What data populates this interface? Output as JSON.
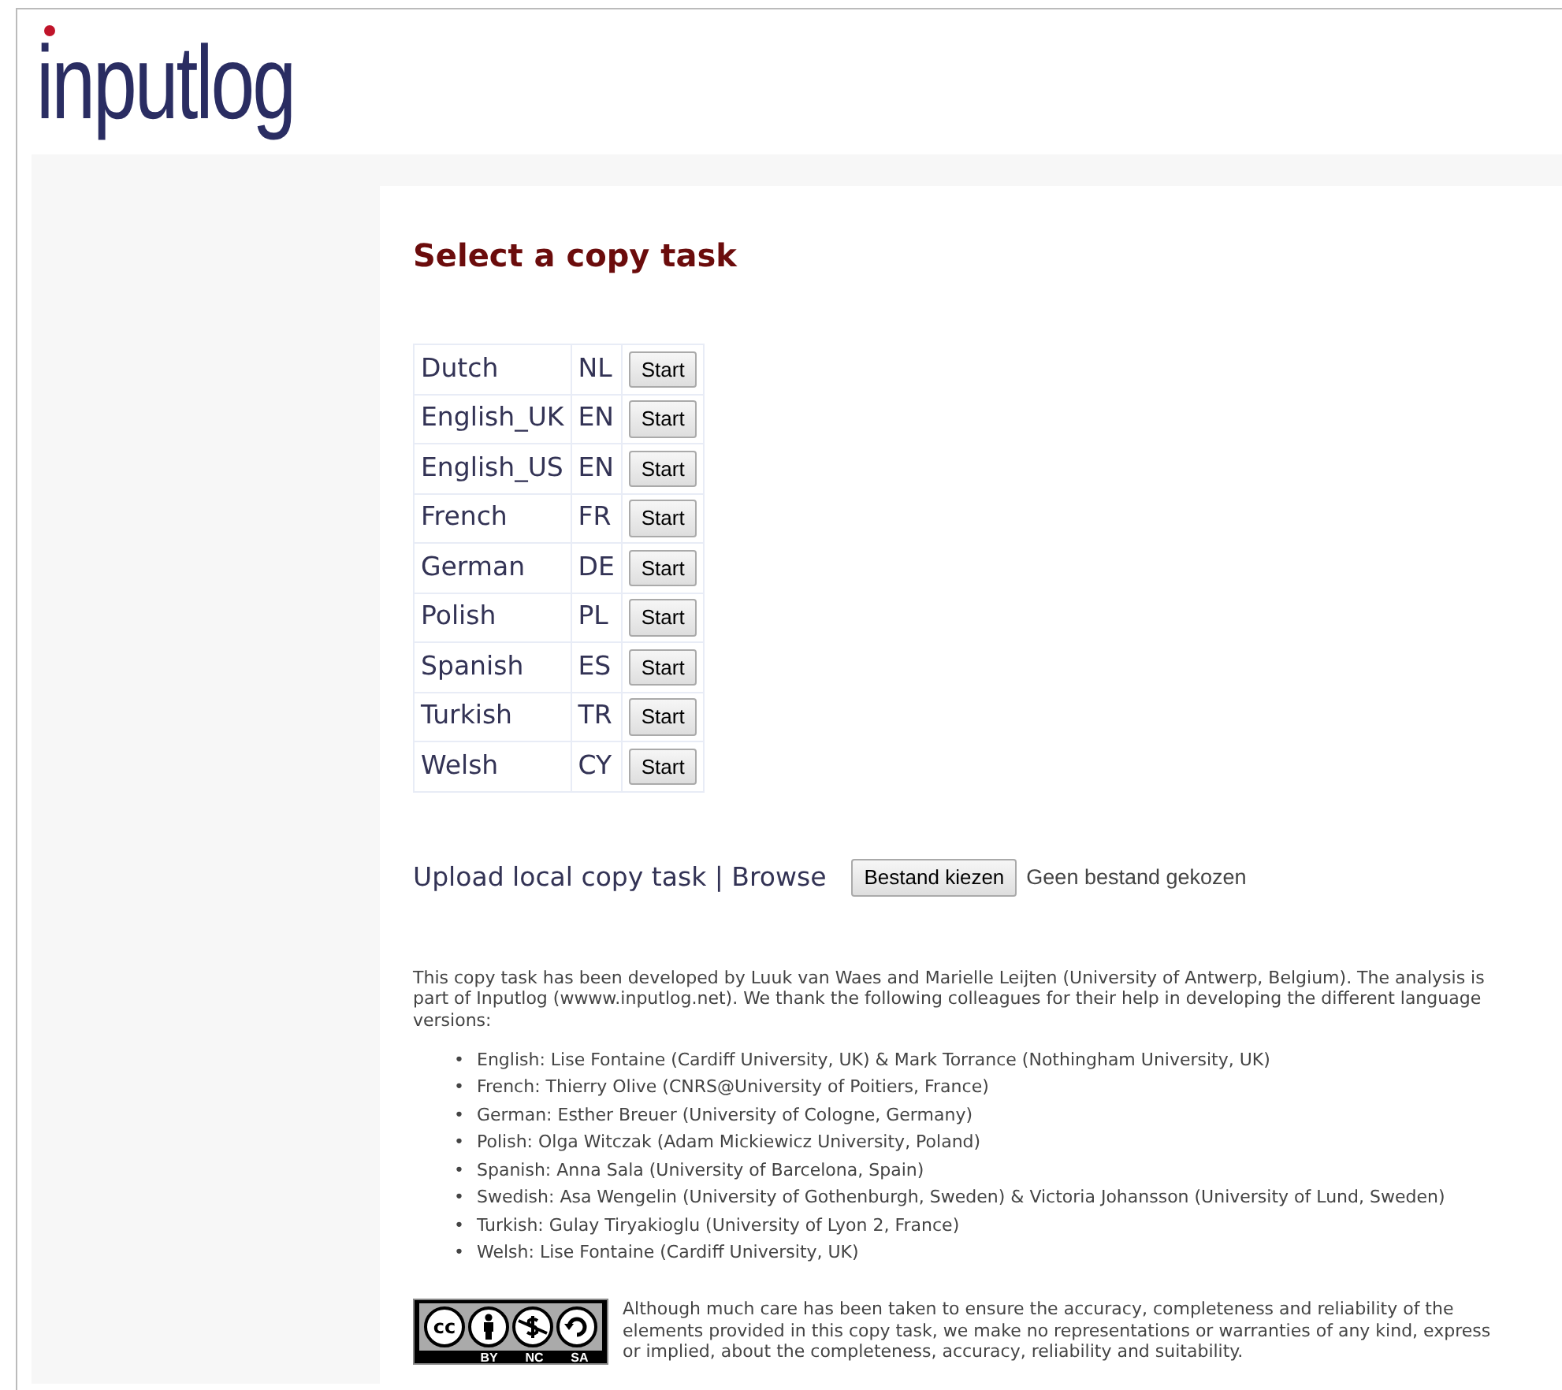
{
  "logo": {
    "text": "inputlog"
  },
  "title": "Select a copy task",
  "tasks": [
    {
      "language": "Dutch",
      "code": "NL",
      "button": "Start"
    },
    {
      "language": "English_UK",
      "code": "EN",
      "button": "Start"
    },
    {
      "language": "English_US",
      "code": "EN",
      "button": "Start"
    },
    {
      "language": "French",
      "code": "FR",
      "button": "Start"
    },
    {
      "language": "German",
      "code": "DE",
      "button": "Start"
    },
    {
      "language": "Polish",
      "code": "PL",
      "button": "Start"
    },
    {
      "language": "Spanish",
      "code": "ES",
      "button": "Start"
    },
    {
      "language": "Turkish",
      "code": "TR",
      "button": "Start"
    },
    {
      "language": "Welsh",
      "code": "CY",
      "button": "Start"
    }
  ],
  "upload": {
    "label": "Upload local copy task | Browse",
    "button": "Bestand kiezen",
    "status": "Geen bestand gekozen"
  },
  "intro": "This copy task has been developed by Luuk van Waes and Marielle Leijten (University of Antwerp, Belgium). The analysis is part of Inputlog (wwww.inputlog.net). We thank the following colleagues for their help in developing the different language versions:",
  "credits": [
    {
      "bullet": "•",
      "text": "English: Lise Fontaine (Cardiff University, UK) & Mark Torrance (Nothingham University, UK)"
    },
    {
      "bullet": "•",
      "text": "French: Thierry Olive (CNRS@University of Poitiers, France)"
    },
    {
      "bullet": "•",
      "text": "German: Esther Breuer (University of Cologne, Germany)"
    },
    {
      "bullet": "•",
      "text": "Polish: Olga Witczak (Adam Mickiewicz University, Poland)"
    },
    {
      "bullet": "•",
      "text": "Spanish: Anna Sala (University of Barcelona, Spain)"
    },
    {
      "bullet": "•",
      "text": "Swedish: Asa Wengelin (University of Gothenburgh, Sweden) & Victoria Johansson (University of Lund, Sweden)"
    },
    {
      "bullet": "•",
      "text": "Turkish: Gulay Tiryakioglu (University of Lyon 2, France)"
    },
    {
      "bullet": "•",
      "text": "Welsh: Lise Fontaine (Cardiff University, UK)"
    }
  ],
  "license": {
    "cc": "cc",
    "terms": [
      "BY",
      "NC",
      "SA"
    ]
  },
  "disclaimer": "Although much care has been taken to ensure the accuracy, completeness and reliability of the elements provided in this copy task, we make no representations or warranties of any kind, express or implied, about the completeness, accuracy, reliability and suitability."
}
